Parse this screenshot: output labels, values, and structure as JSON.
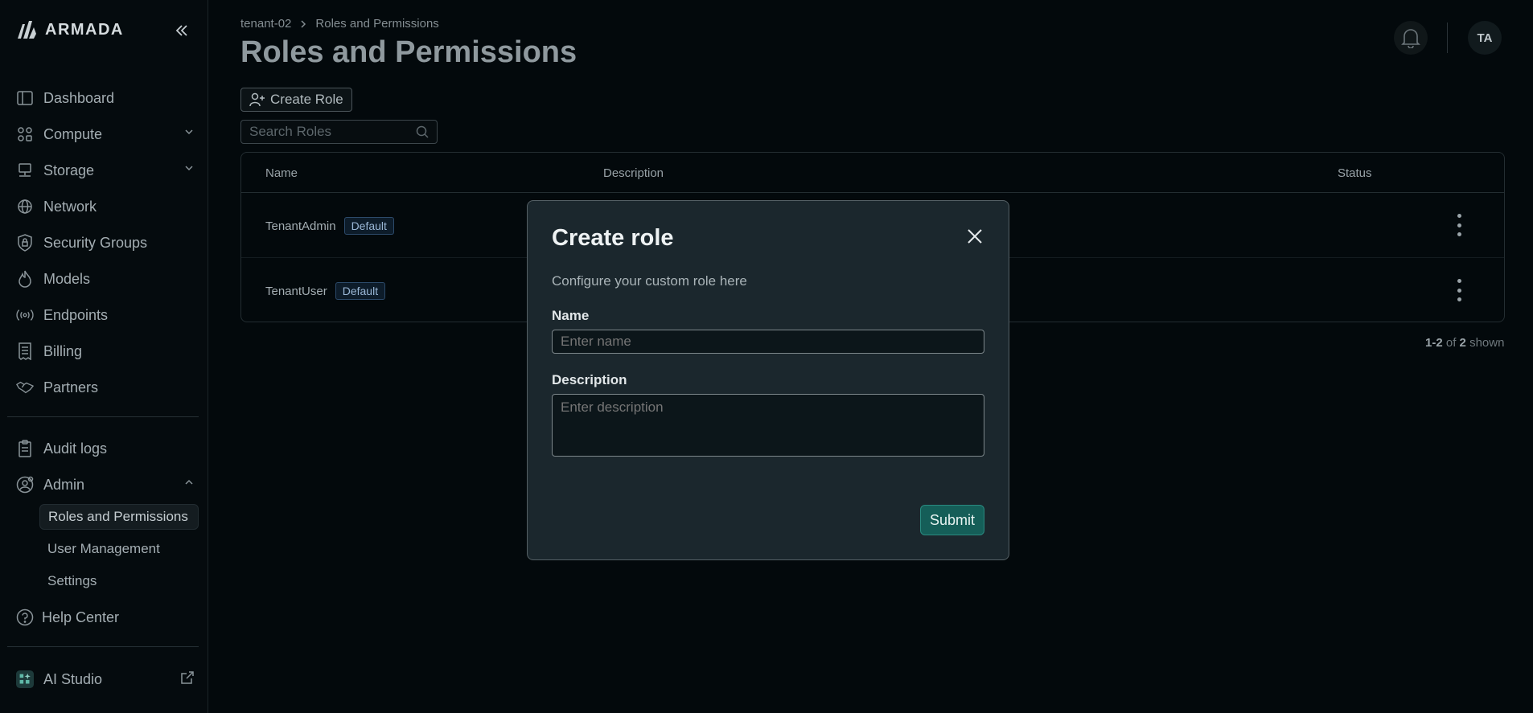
{
  "sidebar": {
    "logo_text": "ARMADA",
    "items": [
      {
        "label": "Dashboard",
        "icon": "sidebar-panel-icon"
      },
      {
        "label": "Compute",
        "icon": "nodes-icon"
      },
      {
        "label": "Storage",
        "icon": "server-icon"
      },
      {
        "label": "Network",
        "icon": "globe-icon"
      },
      {
        "label": "Security Groups",
        "icon": "lock-shield-icon"
      },
      {
        "label": "Models",
        "icon": "flame-icon"
      },
      {
        "label": "Endpoints",
        "icon": "broadcast-icon"
      },
      {
        "label": "Billing",
        "icon": "receipt-icon"
      },
      {
        "label": "Partners",
        "icon": "handshake-icon"
      }
    ],
    "audit_logs": "Audit logs",
    "admin": "Admin",
    "admin_sub": [
      "Roles and Permissions",
      "User Management",
      "Settings"
    ],
    "help_center": "Help Center",
    "ai_studio": "AI Studio"
  },
  "header": {
    "breadcrumb": [
      "tenant-02",
      "Roles and Permissions"
    ],
    "title": "Roles and Permissions",
    "avatar": "TA"
  },
  "toolbar": {
    "create_role": "Create Role",
    "search_placeholder": "Search Roles"
  },
  "table": {
    "columns": [
      "Name",
      "Description",
      "Status"
    ],
    "rows": [
      {
        "name": "TenantAdmin",
        "badge": "Default"
      },
      {
        "name": "TenantUser",
        "badge": "Default"
      }
    ],
    "pagination": {
      "range": "1-2",
      "of": "of",
      "total": "2",
      "suffix": "shown"
    }
  },
  "modal": {
    "title": "Create role",
    "subtitle": "Configure your custom role here",
    "name_label": "Name",
    "name_placeholder": "Enter name",
    "description_label": "Description",
    "description_placeholder": "Enter description",
    "submit": "Submit"
  },
  "colors": {
    "background": "#03090c",
    "modal": "#1b272d",
    "submit": "#155e58",
    "badge_border": "#2c4a6a"
  }
}
